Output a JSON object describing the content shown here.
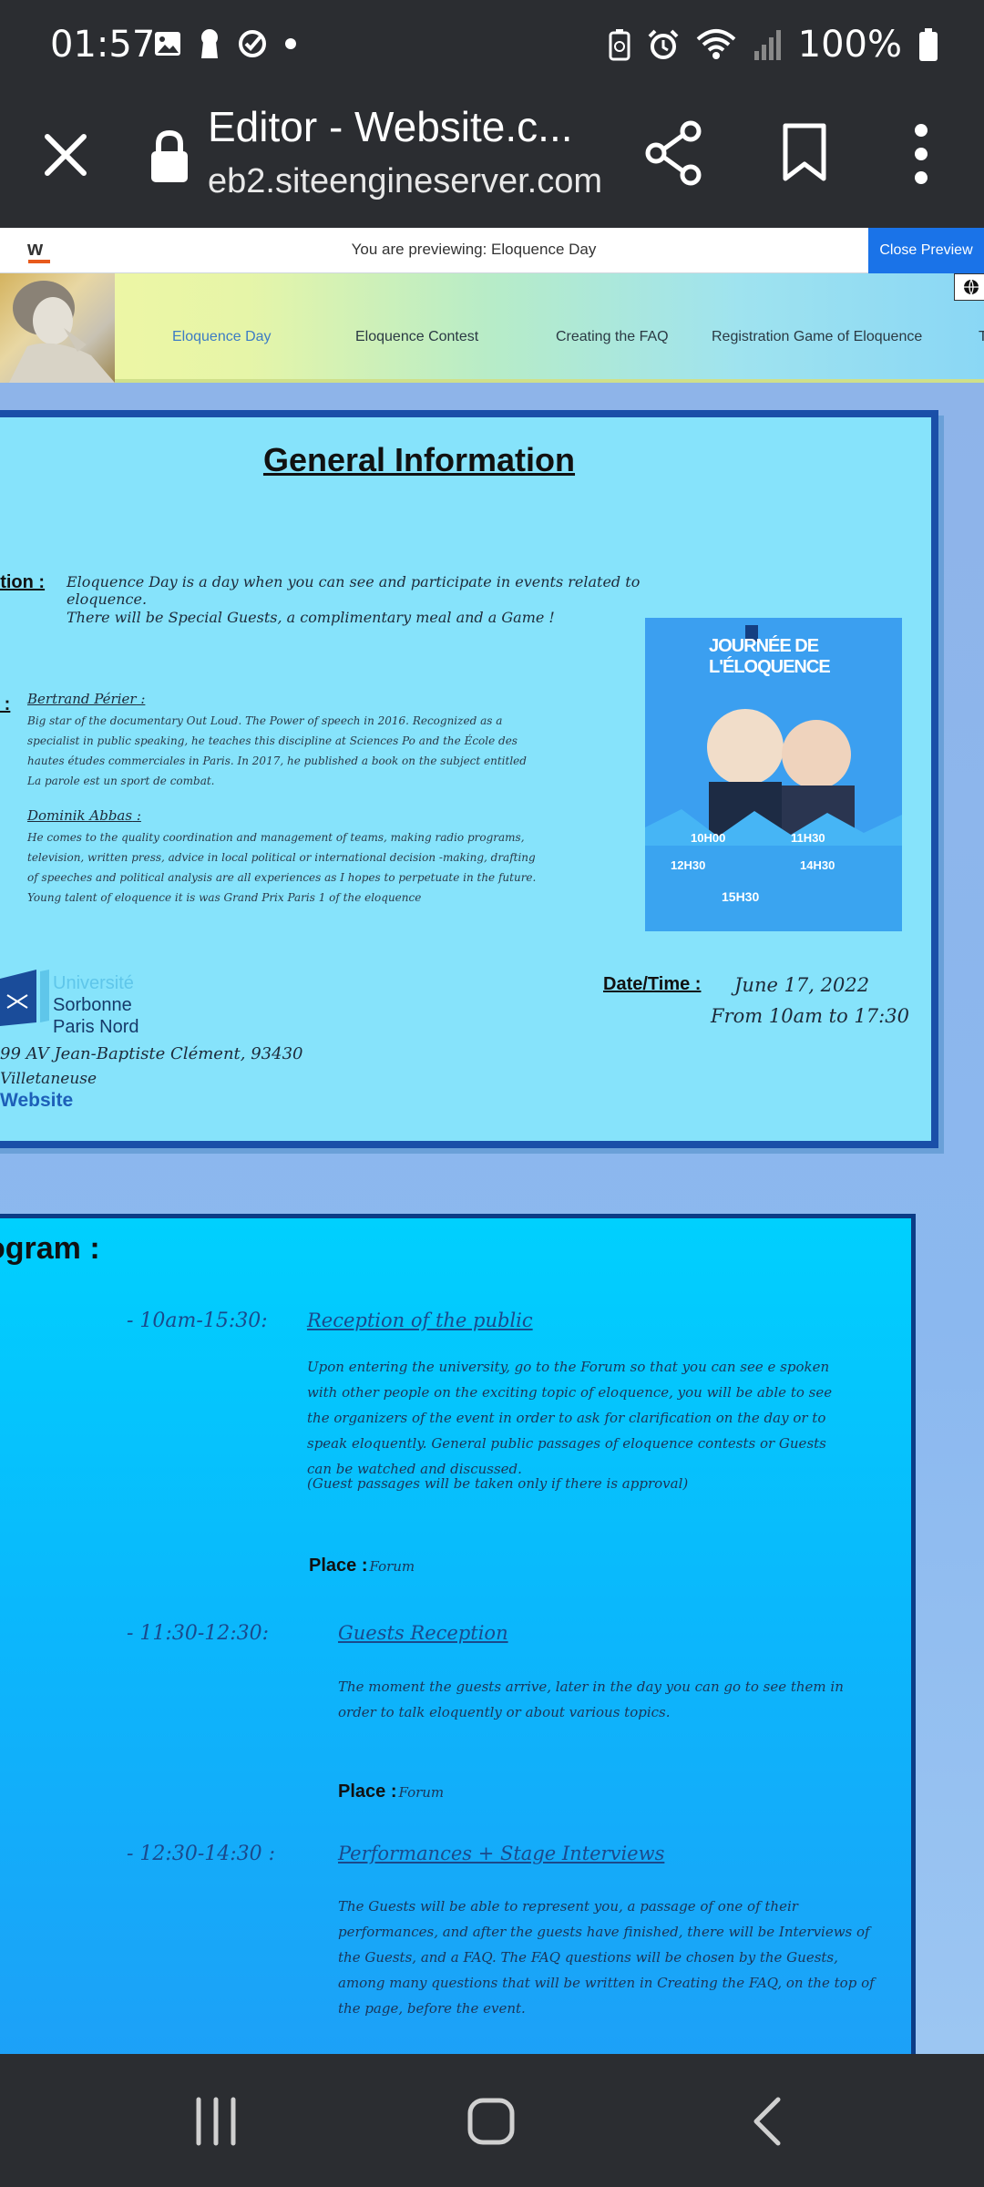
{
  "status_bar": {
    "time": "01:57",
    "battery_text": "100%",
    "left_icons": [
      "gallery-icon",
      "keyhole-icon",
      "check-circle-icon",
      "dot-icon"
    ],
    "right_icons": [
      "battery-saver-icon",
      "alarm-icon",
      "wifi-icon",
      "signal-icon",
      "battery-icon"
    ]
  },
  "browser": {
    "title": "Editor - Website.c...",
    "url": "eb2.siteengineserver.com"
  },
  "preview_bar": {
    "text": "You are previewing: Eloquence Day",
    "close_label": "Close Preview"
  },
  "site_nav": {
    "items": [
      "Eloquence Day",
      "Eloquence Contest",
      "Creating the FAQ",
      "Registration Game of Eloquence",
      "T"
    ]
  },
  "general_info": {
    "title": "General Information",
    "description_label": "ption :",
    "description_line1": "Eloquence Day is a day when you can see and participate in events related to eloquence.",
    "description_line2": "There will be Special Guests, a complimentary meal and a Game !",
    "guests_label": "s :",
    "guests": [
      {
        "name": "Bertrand Périer",
        "suffix": " :",
        "text": "Big star of the documentary Out Loud. The Power of speech in 2016. Recognized as a specialist in public speaking, he teaches this discipline at Sciences Po and the École des hautes études commerciales in Paris. In 2017, he published a book on the subject entitled La parole est un sport de combat."
      },
      {
        "name": "Dominik Abbas",
        "suffix": " :",
        "text": "He comes to the quality coordination and management of teams, making radio programs, television, written press, advice in local political or international decision -making, drafting of speeches and political analysis are all experiences as I hopes to perpetuate in the future. Young talent of eloquence it is was Grand Prix Paris 1 of the eloquence"
      }
    ],
    "poster": {
      "title": "JOURNÉE DE L'ÉLOQUENCE",
      "schedule": [
        "10H00",
        "11H30",
        "12H30",
        "14H30",
        "15H30"
      ]
    },
    "university": {
      "line1": "Université",
      "line2": "Sorbonne",
      "line3": "Paris Nord"
    },
    "address_line1": "99 AV Jean-Baptiste Clément, 93430",
    "address_line2": "Villetaneuse",
    "website_label": "Website",
    "date_label": "Date/Time :",
    "date": "June 17, 2022",
    "time": "From 10am to 17:30"
  },
  "program": {
    "title": "ogram :",
    "events": [
      {
        "time": "- 10am-15:30:",
        "title": "Reception of the public",
        "text": "Upon entering the university, go to the Forum so that you can see e spoken with other people on the exciting topic of eloquence, you will be able to see the organizers of the event in order to ask for clarification on the day or to speak eloquently. General public passages of eloquence contests or Guests can be watched and discussed.",
        "note": "(Guest passages will be taken only if there is approval)",
        "place_label": "Place :",
        "place": "Forum"
      },
      {
        "time": "- 11:30-12:30:",
        "title": "Guests Reception",
        "text": "The moment the guests arrive, later in the day you can go to see them in order to talk eloquently or about various topics.",
        "place_label": "Place :",
        "place": "Forum"
      },
      {
        "time": "- 12:30-14:30 :",
        "title": "Performances + Stage Interviews",
        "text": "The Guests will be able to represent you, a passage of one of their performances, and after the guests have finished, there will be Interviews of the Guests, and a FAQ. The FAQ questions will be chosen by the Guests, among many questions that will be written in Creating the FAQ, on the top of the page, before the event."
      }
    ]
  },
  "colors": {
    "system_bar": "#2b2d31",
    "info_card": "#86e3fb",
    "card_border": "#1a4fa8",
    "program_card": "#0ab8fc",
    "close_preview": "#1a73e8"
  }
}
